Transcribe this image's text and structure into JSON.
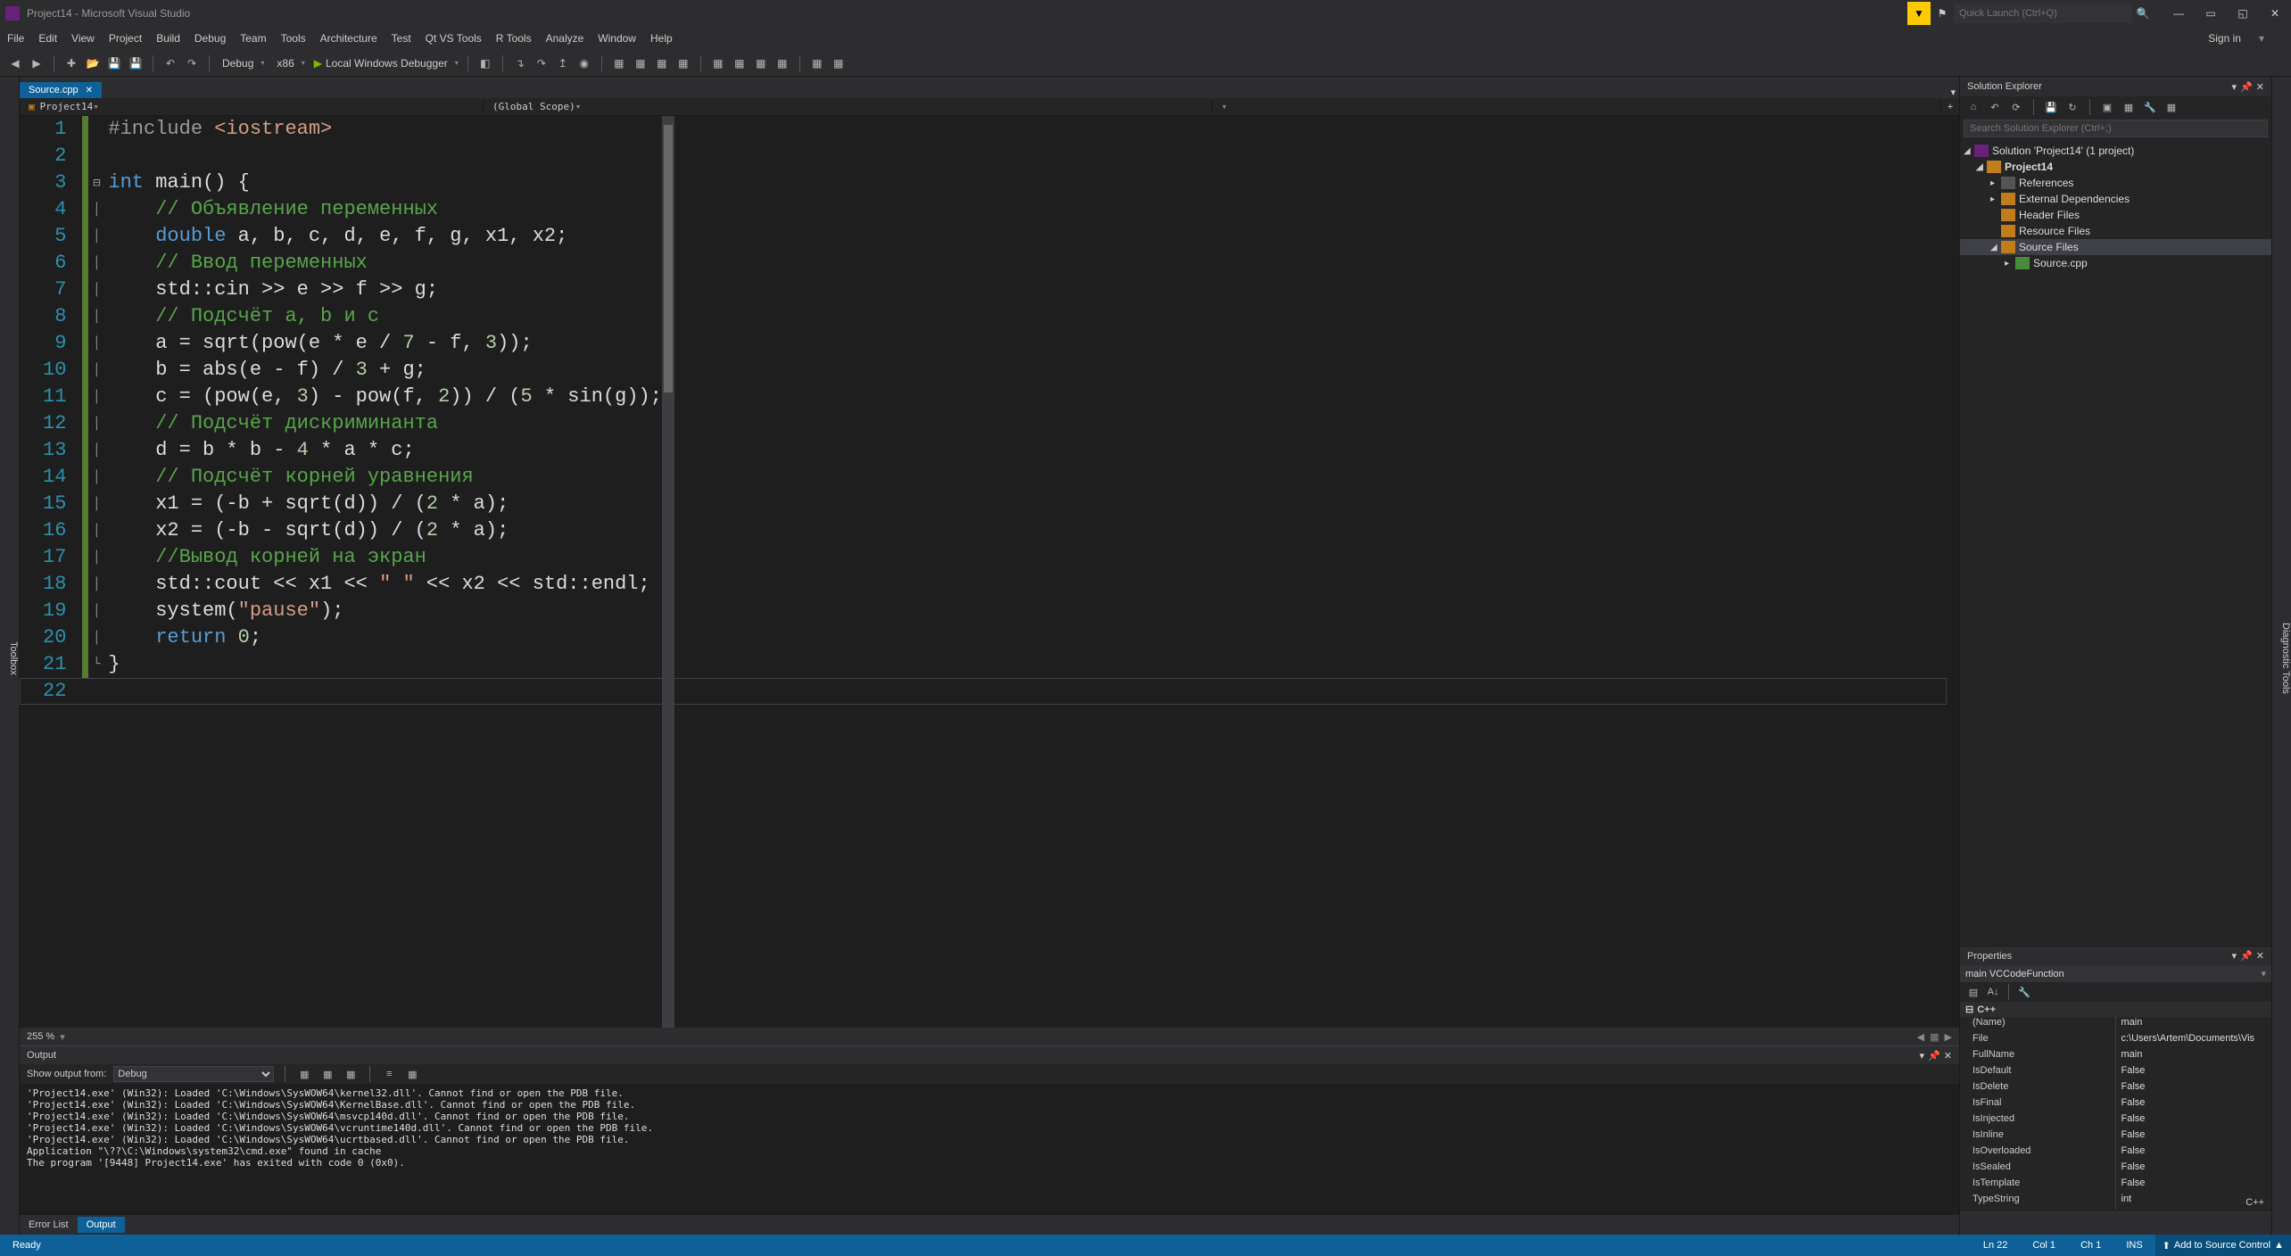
{
  "titlebar": {
    "title": "Project14 - Microsoft Visual Studio",
    "quick_launch_placeholder": "Quick Launch (Ctrl+Q)"
  },
  "menubar": {
    "items": [
      "File",
      "Edit",
      "View",
      "Project",
      "Build",
      "Debug",
      "Team",
      "Tools",
      "Architecture",
      "Test",
      "Qt VS Tools",
      "R Tools",
      "Analyze",
      "Window",
      "Help"
    ],
    "signin": "Sign in"
  },
  "toolbar": {
    "config": "Debug",
    "platform": "x86",
    "debugger": "Local Windows Debugger"
  },
  "left_rail": {
    "toolbox": "Toolbox"
  },
  "editor_tab": {
    "name": "Source.cpp"
  },
  "navbar": {
    "project": "Project14",
    "scope": "(Global Scope)",
    "member": ""
  },
  "code": {
    "lines": [
      {
        "n": 1,
        "chg": true,
        "fold": "",
        "segs": [
          [
            "pre",
            "#include "
          ],
          [
            "str",
            "<iostream>"
          ]
        ]
      },
      {
        "n": 2,
        "chg": true,
        "fold": "",
        "segs": []
      },
      {
        "n": 3,
        "chg": true,
        "fold": "⊟",
        "segs": [
          [
            "kw",
            "int"
          ],
          [
            "txt",
            " main() {"
          ]
        ]
      },
      {
        "n": 4,
        "chg": true,
        "fold": "|",
        "segs": [
          [
            "txt",
            "    "
          ],
          [
            "com",
            "// Объявление переменных"
          ]
        ]
      },
      {
        "n": 5,
        "chg": true,
        "fold": "|",
        "segs": [
          [
            "txt",
            "    "
          ],
          [
            "kw",
            "double"
          ],
          [
            "txt",
            " a, b, c, d, e, f, g, x1, x2;"
          ]
        ]
      },
      {
        "n": 6,
        "chg": true,
        "fold": "|",
        "segs": [
          [
            "txt",
            "    "
          ],
          [
            "com",
            "// Ввод переменных"
          ]
        ]
      },
      {
        "n": 7,
        "chg": true,
        "fold": "|",
        "segs": [
          [
            "txt",
            "    std::cin >> e >> f >> g;"
          ]
        ]
      },
      {
        "n": 8,
        "chg": true,
        "fold": "|",
        "segs": [
          [
            "txt",
            "    "
          ],
          [
            "com",
            "// Подсчёт a, b и c"
          ]
        ]
      },
      {
        "n": 9,
        "chg": true,
        "fold": "|",
        "segs": [
          [
            "txt",
            "    a = sqrt(pow(e * e / "
          ],
          [
            "num",
            "7"
          ],
          [
            "txt",
            " - f, "
          ],
          [
            "num",
            "3"
          ],
          [
            "txt",
            "));"
          ]
        ]
      },
      {
        "n": 10,
        "chg": true,
        "fold": "|",
        "segs": [
          [
            "txt",
            "    b = abs(e - f) / "
          ],
          [
            "num",
            "3"
          ],
          [
            "txt",
            " + g;"
          ]
        ]
      },
      {
        "n": 11,
        "chg": true,
        "fold": "|",
        "segs": [
          [
            "txt",
            "    c = (pow(e, "
          ],
          [
            "num",
            "3"
          ],
          [
            "txt",
            ") - pow(f, "
          ],
          [
            "num",
            "2"
          ],
          [
            "txt",
            ")) / ("
          ],
          [
            "num",
            "5"
          ],
          [
            "txt",
            " * sin(g));"
          ]
        ]
      },
      {
        "n": 12,
        "chg": true,
        "fold": "|",
        "segs": [
          [
            "txt",
            "    "
          ],
          [
            "com",
            "// Подсчёт дискриминанта"
          ]
        ]
      },
      {
        "n": 13,
        "chg": true,
        "fold": "|",
        "segs": [
          [
            "txt",
            "    d = b * b - "
          ],
          [
            "num",
            "4"
          ],
          [
            "txt",
            " * a * c;"
          ]
        ]
      },
      {
        "n": 14,
        "chg": true,
        "fold": "|",
        "segs": [
          [
            "txt",
            "    "
          ],
          [
            "com",
            "// Подсчёт корней уравнения"
          ]
        ]
      },
      {
        "n": 15,
        "chg": true,
        "fold": "|",
        "segs": [
          [
            "txt",
            "    x1 = (-b + sqrt(d)) / ("
          ],
          [
            "num",
            "2"
          ],
          [
            "txt",
            " * a);"
          ]
        ]
      },
      {
        "n": 16,
        "chg": true,
        "fold": "|",
        "segs": [
          [
            "txt",
            "    x2 = (-b - sqrt(d)) / ("
          ],
          [
            "num",
            "2"
          ],
          [
            "txt",
            " * a);"
          ]
        ]
      },
      {
        "n": 17,
        "chg": true,
        "fold": "|",
        "segs": [
          [
            "txt",
            "    "
          ],
          [
            "com",
            "//Вывод корней на экран"
          ]
        ]
      },
      {
        "n": 18,
        "chg": true,
        "fold": "|",
        "segs": [
          [
            "txt",
            "    std::cout << x1 << "
          ],
          [
            "str",
            "\" \""
          ],
          [
            "txt",
            " << x2 << std::endl;"
          ]
        ]
      },
      {
        "n": 19,
        "chg": true,
        "fold": "|",
        "segs": [
          [
            "txt",
            "    system("
          ],
          [
            "str",
            "\"pause\""
          ],
          [
            "txt",
            ");"
          ]
        ]
      },
      {
        "n": 20,
        "chg": true,
        "fold": "|",
        "segs": [
          [
            "txt",
            "    "
          ],
          [
            "kw",
            "return"
          ],
          [
            "txt",
            " "
          ],
          [
            "num",
            "0"
          ],
          [
            "txt",
            ";"
          ]
        ]
      },
      {
        "n": 21,
        "chg": true,
        "fold": "└",
        "segs": [
          [
            "txt",
            "}"
          ]
        ]
      },
      {
        "n": 22,
        "chg": false,
        "fold": "",
        "segs": []
      }
    ],
    "current_line_index": 21
  },
  "zoom": {
    "pct": "255 %"
  },
  "output": {
    "title": "Output",
    "show_label": "Show output from:",
    "source": "Debug",
    "body": "'Project14.exe' (Win32): Loaded 'C:\\Windows\\SysWOW64\\kernel32.dll'. Cannot find or open the PDB file.\n'Project14.exe' (Win32): Loaded 'C:\\Windows\\SysWOW64\\KernelBase.dll'. Cannot find or open the PDB file.\n'Project14.exe' (Win32): Loaded 'C:\\Windows\\SysWOW64\\msvcp140d.dll'. Cannot find or open the PDB file.\n'Project14.exe' (Win32): Loaded 'C:\\Windows\\SysWOW64\\vcruntime140d.dll'. Cannot find or open the PDB file.\n'Project14.exe' (Win32): Loaded 'C:\\Windows\\SysWOW64\\ucrtbased.dll'. Cannot find or open the PDB file.\nApplication \"\\??\\C:\\Windows\\system32\\cmd.exe\" found in cache\nThe program '[9448] Project14.exe' has exited with code 0 (0x0).",
    "tabs": {
      "errorlist": "Error List",
      "output": "Output"
    }
  },
  "lang_strip": {
    "lang": "C++"
  },
  "solution_explorer": {
    "title": "Solution Explorer",
    "search_placeholder": "Search Solution Explorer (Ctrl+;)",
    "solution": "Solution 'Project14' (1 project)",
    "project": "Project14",
    "references": "References",
    "external_deps": "External Dependencies",
    "header_files": "Header Files",
    "resource_files": "Resource Files",
    "source_files": "Source Files",
    "source_cpp": "Source.cpp"
  },
  "properties": {
    "title": "Properties",
    "header": "main  VCCodeFunction",
    "category": "C++",
    "rows": [
      {
        "k": "(Name)",
        "v": "main"
      },
      {
        "k": "File",
        "v": "c:\\Users\\Artem\\Documents\\Vis"
      },
      {
        "k": "FullName",
        "v": "main"
      },
      {
        "k": "IsDefault",
        "v": "False"
      },
      {
        "k": "IsDelete",
        "v": "False"
      },
      {
        "k": "IsFinal",
        "v": "False"
      },
      {
        "k": "IsInjected",
        "v": "False"
      },
      {
        "k": "IsInline",
        "v": "False"
      },
      {
        "k": "IsOverloaded",
        "v": "False"
      },
      {
        "k": "IsSealed",
        "v": "False"
      },
      {
        "k": "IsTemplate",
        "v": "False"
      },
      {
        "k": "TypeString",
        "v": "int"
      }
    ]
  },
  "right_rail": {
    "diag": "Diagnostic Tools"
  },
  "statusbar": {
    "ready": "Ready",
    "ln": "Ln 22",
    "col": "Col 1",
    "ch": "Ch 1",
    "ins": "INS",
    "source_control": "Add to Source Control",
    "caret": "▲"
  }
}
